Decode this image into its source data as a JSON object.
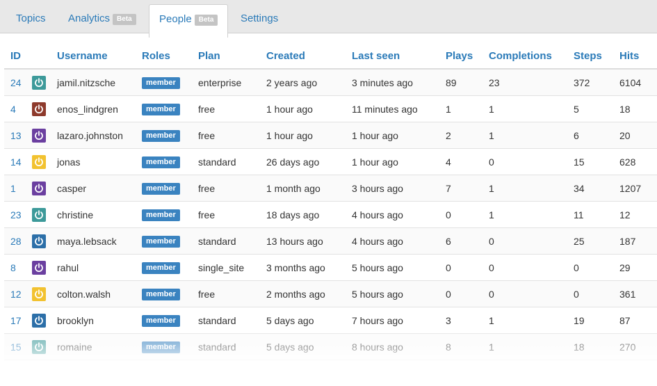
{
  "tabs": [
    {
      "label": "Topics",
      "badge": ""
    },
    {
      "label": "Analytics",
      "badge": "Beta"
    },
    {
      "label": "People",
      "badge": "Beta"
    },
    {
      "label": "Settings",
      "badge": ""
    }
  ],
  "columns": {
    "id": "ID",
    "username": "Username",
    "roles": "Roles",
    "plan": "Plan",
    "created": "Created",
    "last_seen": "Last seen",
    "plays": "Plays",
    "completions": "Completions",
    "steps": "Steps",
    "hits": "Hits"
  },
  "colors": {
    "link": "#2a7ab8",
    "role_badge": "#3a83c0",
    "beta_badge": "#c4c4c4"
  },
  "rows": [
    {
      "id": "24",
      "avatar_color": "#3d9a9a",
      "username": "jamil.nitzsche",
      "role": "member",
      "plan": "enterprise",
      "created": "2 years ago",
      "last_seen": "3 minutes ago",
      "plays": "89",
      "completions": "23",
      "steps": "372",
      "hits": "6104"
    },
    {
      "id": "4",
      "avatar_color": "#8e3a2c",
      "username": "enos_lindgren",
      "role": "member",
      "plan": "free",
      "created": "1 hour ago",
      "last_seen": "11 minutes ago",
      "plays": "1",
      "completions": "1",
      "steps": "5",
      "hits": "18"
    },
    {
      "id": "13",
      "avatar_color": "#6b3fa0",
      "username": "lazaro.johnston",
      "role": "member",
      "plan": "free",
      "created": "1 hour ago",
      "last_seen": "1 hour ago",
      "plays": "2",
      "completions": "1",
      "steps": "6",
      "hits": "20"
    },
    {
      "id": "14",
      "avatar_color": "#f2c230",
      "username": "jonas",
      "role": "member",
      "plan": "standard",
      "created": "26 days ago",
      "last_seen": "1 hour ago",
      "plays": "4",
      "completions": "0",
      "steps": "15",
      "hits": "628"
    },
    {
      "id": "1",
      "avatar_color": "#6b3fa0",
      "username": "casper",
      "role": "member",
      "plan": "free",
      "created": "1 month ago",
      "last_seen": "3 hours ago",
      "plays": "7",
      "completions": "1",
      "steps": "34",
      "hits": "1207"
    },
    {
      "id": "23",
      "avatar_color": "#3d9a9a",
      "username": "christine",
      "role": "member",
      "plan": "free",
      "created": "18 days ago",
      "last_seen": "4 hours ago",
      "plays": "0",
      "completions": "1",
      "steps": "11",
      "hits": "12"
    },
    {
      "id": "28",
      "avatar_color": "#2c6fa8",
      "username": "maya.lebsack",
      "role": "member",
      "plan": "standard",
      "created": "13 hours ago",
      "last_seen": "4 hours ago",
      "plays": "6",
      "completions": "0",
      "steps": "25",
      "hits": "187"
    },
    {
      "id": "8",
      "avatar_color": "#6b3fa0",
      "username": "rahul",
      "role": "member",
      "plan": "single_site",
      "created": "3 months ago",
      "last_seen": "5 hours ago",
      "plays": "0",
      "completions": "0",
      "steps": "0",
      "hits": "29"
    },
    {
      "id": "12",
      "avatar_color": "#f2c230",
      "username": "colton.walsh",
      "role": "member",
      "plan": "free",
      "created": "2 months ago",
      "last_seen": "5 hours ago",
      "plays": "0",
      "completions": "0",
      "steps": "0",
      "hits": "361"
    },
    {
      "id": "17",
      "avatar_color": "#2c6fa8",
      "username": "brooklyn",
      "role": "member",
      "plan": "standard",
      "created": "5 days ago",
      "last_seen": "7 hours ago",
      "plays": "3",
      "completions": "1",
      "steps": "19",
      "hits": "87"
    },
    {
      "id": "15",
      "avatar_color": "#3d9a9a",
      "username": "romaine",
      "role": "member",
      "plan": "standard",
      "created": "5 days ago",
      "last_seen": "8 hours ago",
      "plays": "8",
      "completions": "1",
      "steps": "18",
      "hits": "270"
    }
  ]
}
